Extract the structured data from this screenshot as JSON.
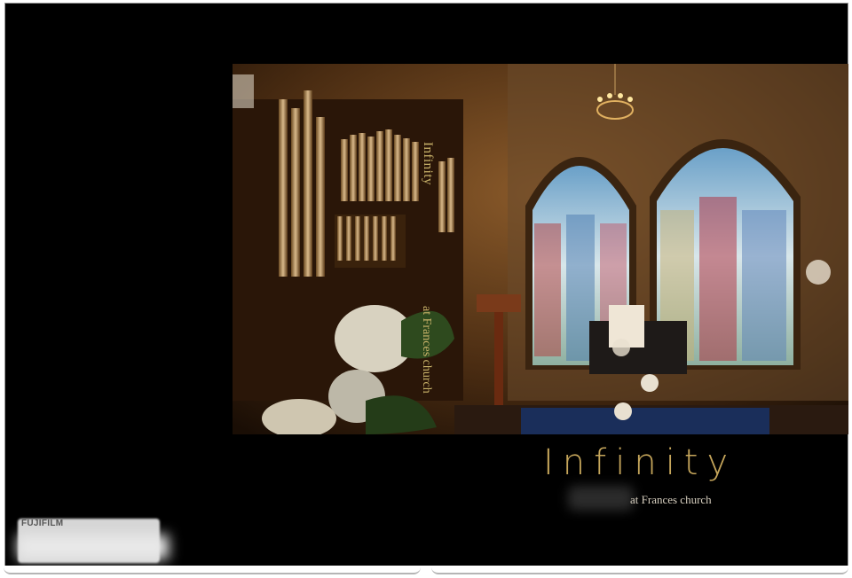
{
  "cover": {
    "title": "Infinity",
    "subtitle": "at Frances church",
    "title_color": "#c6a65b"
  },
  "spine": {
    "title": "Infinity",
    "subtitle": "at Frances church"
  },
  "brand": {
    "name_part1": "FUJI",
    "name_part2": "FILM",
    "accent_color": "#c21a1a"
  },
  "photo": {
    "subject": "church-interior-with-stained-glass-and-organ"
  }
}
